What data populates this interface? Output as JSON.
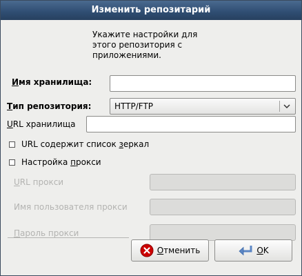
{
  "window": {
    "title": "Изменить репозитарий"
  },
  "intro": {
    "line1": "Укажите настройки для",
    "line2": "этого репозитория с",
    "line3": "приложениями."
  },
  "repo_name": {
    "label_first": "И",
    "label_rest": "мя хранилища:",
    "value": ""
  },
  "repo_type": {
    "label_first": "Т",
    "label_rest": "ип репозитория:",
    "selected": "HTTP/FTP"
  },
  "repo_url": {
    "label_first": "U",
    "label_rest": "RL хранилища",
    "value": ""
  },
  "mirror_list": {
    "label_before": "URL содержит список ",
    "label_u": "з",
    "label_after": "еркал",
    "checked": false
  },
  "proxy": {
    "label_before": "Настройка ",
    "label_u": "п",
    "label_after": "рокси",
    "checked": false
  },
  "proxy_url": {
    "label_first": "U",
    "label_rest": "RL прокси"
  },
  "proxy_user": {
    "label": "Имя пользователя прокси"
  },
  "proxy_password": {
    "label_first": "П",
    "label_rest": "ароль прокси"
  },
  "buttons": {
    "cancel": {
      "before": "",
      "u": "О",
      "after": "тменить"
    },
    "ok": {
      "u": "O",
      "after": "K"
    }
  },
  "colors": {
    "titlebar": "#2f4d72",
    "window_bg": "#eeeeec",
    "cancel_icon": "#cc0000",
    "ok_icon": "#5b86c4"
  },
  "icons": {
    "cancel": "cancel-icon",
    "ok": "ok-icon",
    "dropdown": "chevron-down-icon"
  }
}
